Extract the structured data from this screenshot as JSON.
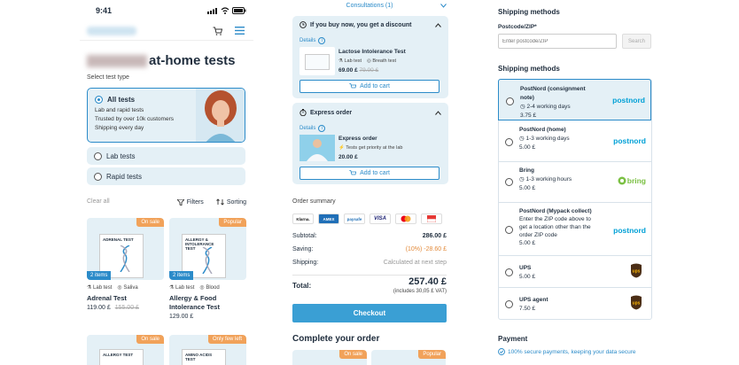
{
  "left": {
    "status_time": "9:41",
    "title_suffix": "at-home tests",
    "select_label": "Select test type",
    "all_tests": {
      "label": "All tests",
      "line1": "Lab and rapid tests",
      "line2": "Trusted by over 10k customers",
      "line3": "Shipping every day"
    },
    "lab_tests": "Lab tests",
    "rapid_tests": "Rapid tests",
    "clear_all": "Clear all",
    "filters": "Filters",
    "sorting": "Sorting",
    "products": [
      {
        "tag": "On sale",
        "box_title": "ADRENAL TEST",
        "items": "2 items",
        "type1": "Lab test",
        "type2": "Saliva",
        "name": "Adrenal Test",
        "price": "119.00 £",
        "old_price": "155.00 £"
      },
      {
        "tag": "Popular",
        "box_title": "ALLERGY & INTOLERANCE TEST",
        "items": "2 items",
        "type1": "Lab test",
        "type2": "Blood",
        "name": "Allergy & Food Intolerance Test",
        "price": "129.00 £",
        "old_price": ""
      },
      {
        "tag": "On sale",
        "box_title": "ALLERGY TEST",
        "items": "",
        "type1": "",
        "type2": "",
        "name": "",
        "price": "",
        "old_price": ""
      },
      {
        "tag": "Only few left",
        "box_title": "AMINO ACIDS TEST",
        "items": "",
        "type1": "",
        "type2": "",
        "name": "",
        "price": "",
        "old_price": ""
      }
    ]
  },
  "middle": {
    "consultations": "Consultations (1)",
    "discount_title": "If you buy now, you get a discount",
    "details": "Details",
    "lactose": {
      "name": "Lactose Intolerance Test",
      "type1": "Lab test",
      "type2": "Breath test",
      "price": "69.00 £",
      "old_price": "79.00 £"
    },
    "add_to_cart": "Add to cart",
    "express_title": "Express order",
    "express": {
      "name": "Express order",
      "desc": "Tests get priority at the lab",
      "price": "20.00 £"
    },
    "order_summary": "Order summary",
    "payment_logos": [
      "Klarna.",
      "AMEX",
      "paysafe",
      "VISA",
      "MC",
      "FLAG"
    ],
    "subtotal_label": "Subtotal:",
    "subtotal": "286.00 £",
    "saving_label": "Saving:",
    "saving": "(10%) -28.60 £",
    "shipping_label": "Shipping:",
    "shipping": "Calculated at next step",
    "total_label": "Total:",
    "total": "257.40 £",
    "vat": "(includes 30,05 £ VAT)",
    "checkout": "Checkout",
    "complete": "Complete your order",
    "bottom_tags": [
      "On sale",
      "Popular"
    ]
  },
  "right": {
    "shipping_methods": "Shipping methods",
    "postcode_label": "Postcode/ZIP*",
    "postcode_placeholder": "Enter postcode/ZIP",
    "search": "Search",
    "methods_heading": "Shipping methods",
    "methods": [
      {
        "name": "PostNord (consignment note)",
        "detail": "2-4 working days",
        "price": "3.75 £",
        "logo": "postnord"
      },
      {
        "name": "PostNord (home)",
        "detail": "1-3 working days",
        "price": "5.00 £",
        "logo": "postnord"
      },
      {
        "name": "Bring",
        "detail": "1-3 working hours",
        "price": "5.00 £",
        "logo": "bring"
      },
      {
        "name": "PostNord (Mypack collect)",
        "detail": "Enter the ZIP code above to get a location other than the order ZIP code",
        "price": "5.00 £",
        "logo": "postnord"
      },
      {
        "name": "UPS",
        "detail": "",
        "price": "5.00 £",
        "logo": "ups"
      },
      {
        "name": "UPS agent",
        "detail": "",
        "price": "7.50 £",
        "logo": "ups"
      }
    ],
    "payment": "Payment",
    "secure": "100% secure payments, keeping your data secure"
  },
  "colors": {
    "accent": "#2b8bc9",
    "card": "#e4f0f6",
    "sale": "#f1a25a",
    "saving": "#e38b3c"
  }
}
